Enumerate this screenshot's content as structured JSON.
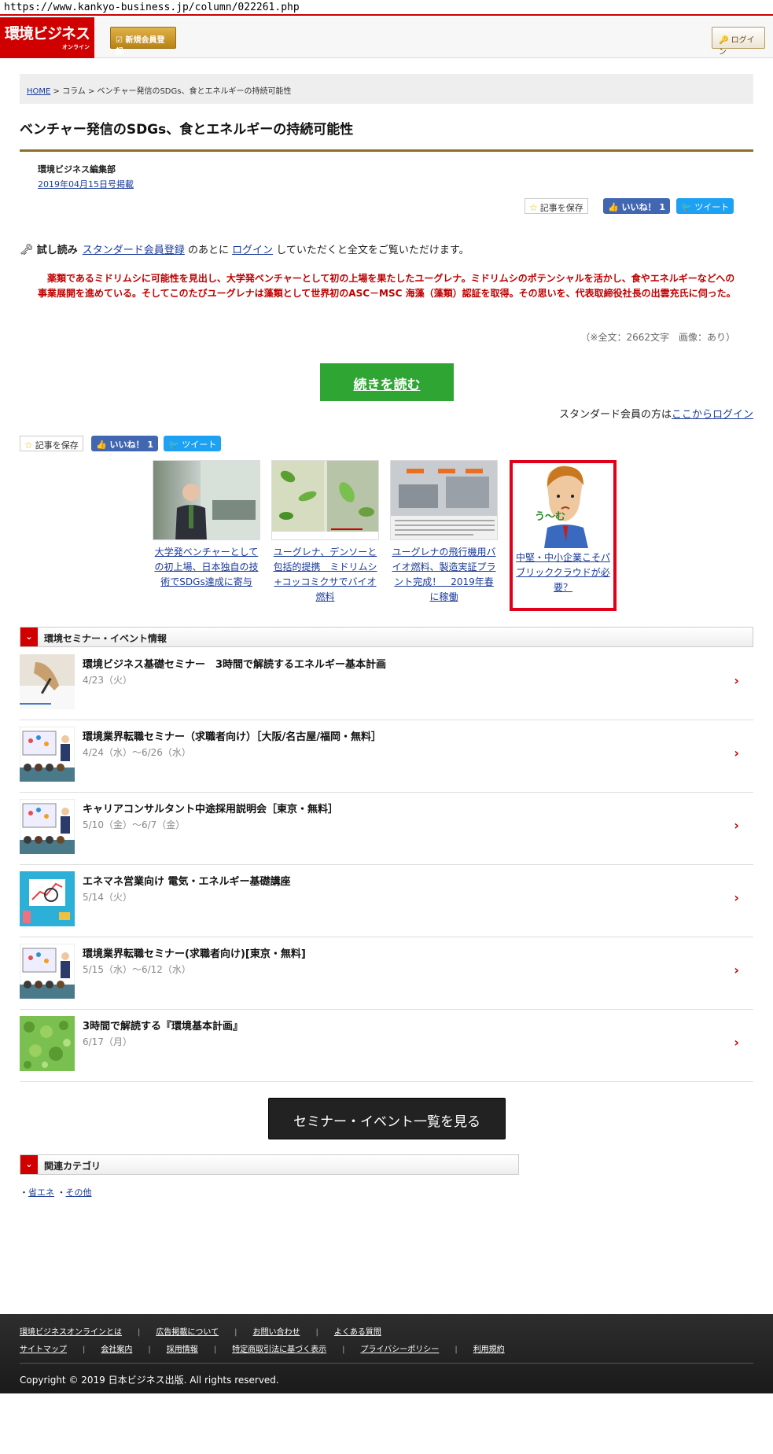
{
  "url": "https://www.kankyo-business.jp/column/022261.php",
  "header": {
    "logo_main": "環境ビジネス",
    "logo_sub": "オンライン",
    "register_label": "新規会員登録",
    "login_label": "ログイン"
  },
  "breadcrumb": {
    "home": "HOME",
    "sep1": " > ",
    "column": "コラム",
    "sep2": " > ",
    "current": "ベンチャー発信のSDGs、食とエネルギーの持続可能性"
  },
  "article": {
    "title": "ベンチャー発信のSDGs、食とエネルギーの持続可能性",
    "author": "環境ビジネス編集部",
    "date": "2019年04月15日号掲載",
    "trial_label": "試し読み",
    "trial_link1": "スタンダード会員登録",
    "trial_mid": "のあとに",
    "trial_link2": "ログイン",
    "trial_end": "していただくと全文をご覧いただけます。",
    "lead": "　薬類であるミドリムシに可能性を見出し、大学発ベンチャーとして初の上場を果たしたユーグレナ。ミドリムシのポテンシャルを活かし、食やエネルギーなどへの事業展開を進めている。そしてこのたびユーグレナは藻類として世界初のASC－MSC 海藻（藻類）認証を取得。その思いを、代表取締役社長の出雲充氏に伺った。",
    "count": "（※全文：2662文字　画像：あり）",
    "readmore": "続きを読む",
    "std_prefix": "スタンダード会員の方は",
    "std_link": "ここからログイン"
  },
  "social": {
    "save": "記事を保存",
    "like": "いいね！ 1",
    "tweet": "ツイート"
  },
  "related": [
    {
      "text": "大学発ベンチャーとしての初上場、日本独自の技術でSDGs達成に寄与"
    },
    {
      "text": "ユーグレナ、デンソーと包括的提携　ミドリムシ+コッコミクサでバイオ燃料"
    },
    {
      "text": "ユーグレナの飛行機用バイオ燃料、製造実証プラント完成！　2019年春に稼働"
    }
  ],
  "ad": {
    "text": "中堅・中小企業こそパブリッククラウドが必要？",
    "bubble": "う〜む"
  },
  "events_section": {
    "title": "環境セミナー・イベント情報"
  },
  "events": [
    {
      "title": "環境ビジネス基礎セミナー　3時間で解読するエネルギー基本計画",
      "date": "4/23（火）"
    },
    {
      "title": "環境業界転職セミナー（求職者向け）［大阪/名古屋/福岡・無料］",
      "date": "4/24（水）～6/26（水）"
    },
    {
      "title": "キャリアコンサルタント中途採用説明会［東京・無料］",
      "date": "5/10（金）～6/7（金）"
    },
    {
      "title": "エネマネ営業向け 電気・エネルギー基礎講座",
      "date": "5/14（火）"
    },
    {
      "title": "環境業界転職セミナー(求職者向け)[東京・無料]",
      "date": "5/15（水）～6/12（水）"
    },
    {
      "title": "3時間で解読する『環境基本計画』",
      "date": "6/17（月）"
    }
  ],
  "seminar_button": "セミナー・イベント一覧を見る",
  "categories": {
    "title": "関連カテゴリ",
    "items": [
      "省エネ",
      "その他"
    ]
  },
  "footer": {
    "row1": [
      "環境ビジネスオンラインとは",
      "広告掲載について",
      "お問い合わせ",
      "よくある質問"
    ],
    "row2": [
      "サイトマップ",
      "会社案内",
      "採用情報",
      "特定商取引法に基づく表示",
      "プライバシーポリシー",
      "利用規約"
    ],
    "copyright": "Copyright © 2019 日本ビジネス出版. All rights reserved."
  },
  "colors": {
    "brand_red": "#d10000",
    "lead_red": "#c00000",
    "readmore_green": "#2fa534",
    "facebook": "#4267b2",
    "twitter": "#1da1f2"
  }
}
